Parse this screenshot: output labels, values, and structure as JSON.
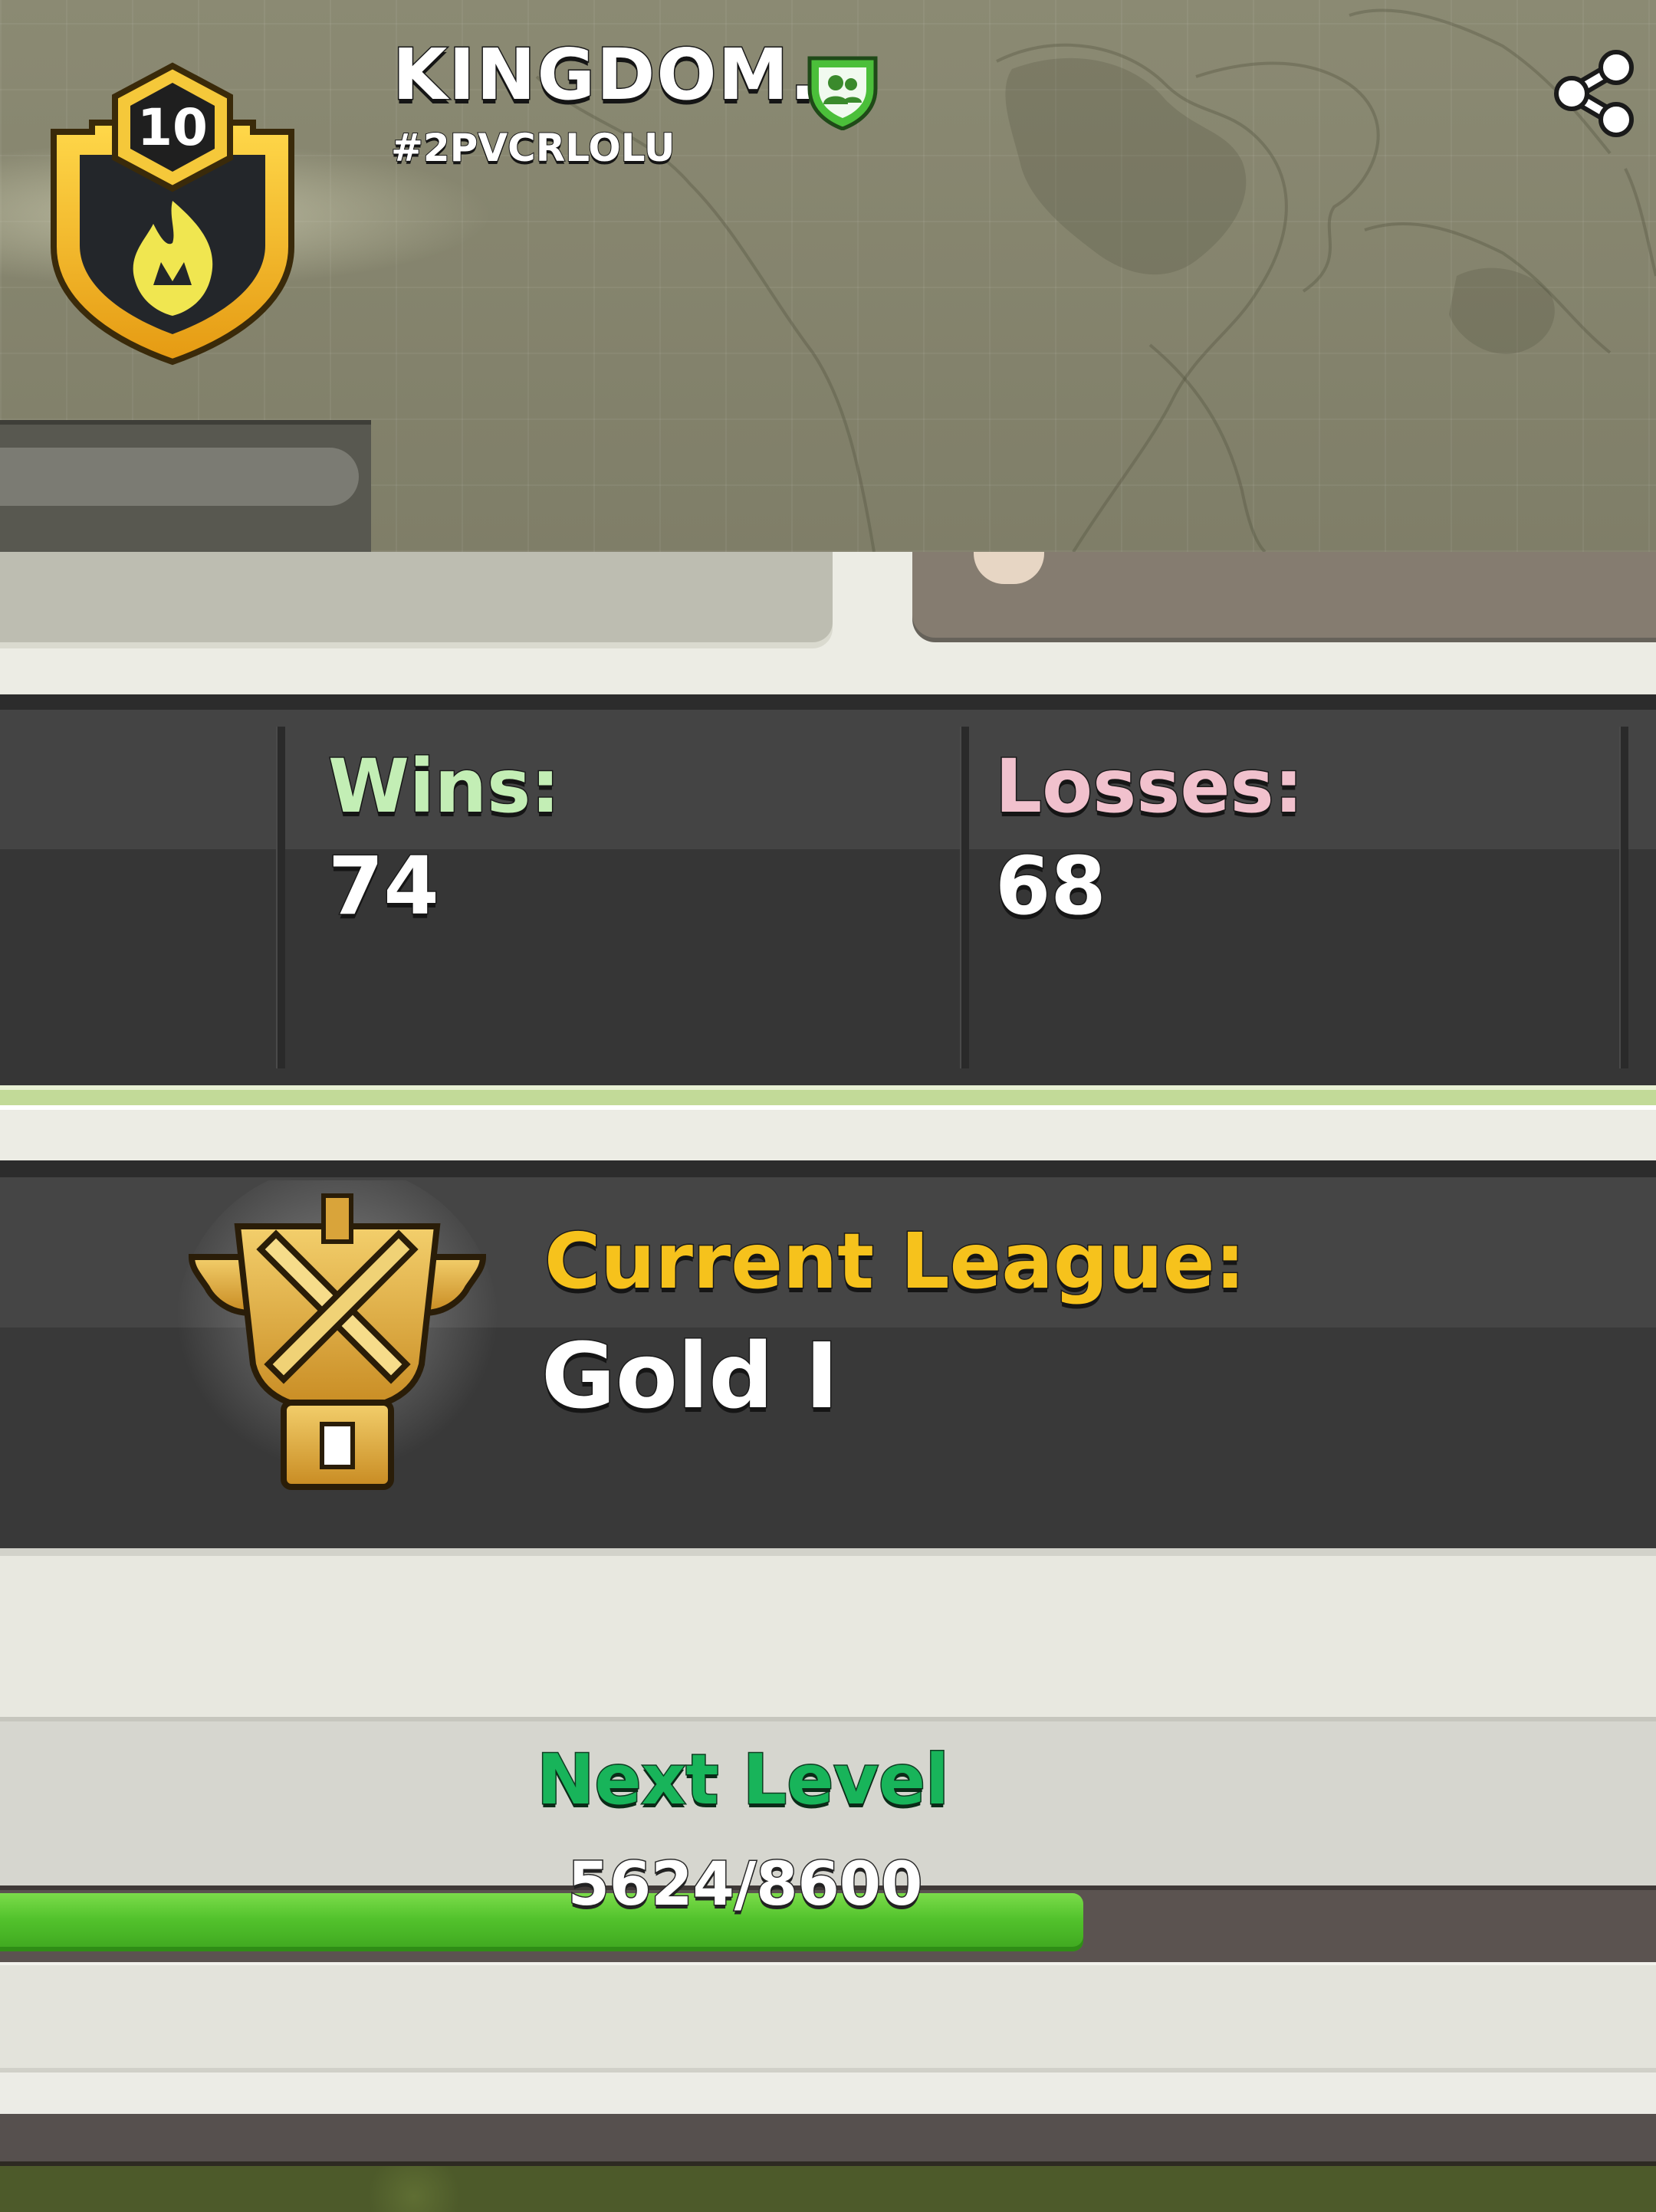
{
  "clan": {
    "name": "KINGDOM.",
    "tag": "#2PVCRLOLU",
    "level": "10"
  },
  "stats": {
    "wins_label": "Wins:",
    "wins_value": "74",
    "losses_label": "Losses:",
    "losses_value": "68"
  },
  "league": {
    "label": "Current League:",
    "value": "Gold I",
    "badge_numeral": "I"
  },
  "next_level": {
    "label": "Next Level",
    "progress_text": "5624/8600",
    "current": 5624,
    "max": 8600
  },
  "colors": {
    "wins": "#c3eeb5",
    "losses": "#f1c1cd",
    "league_label": "#f6c21c",
    "next_level": "#18b45a",
    "progress_fill": "#52c22c"
  },
  "icons": [
    "clan-badge-icon",
    "clan-type-shield-icon",
    "share-icon",
    "league-trophy-icon"
  ]
}
